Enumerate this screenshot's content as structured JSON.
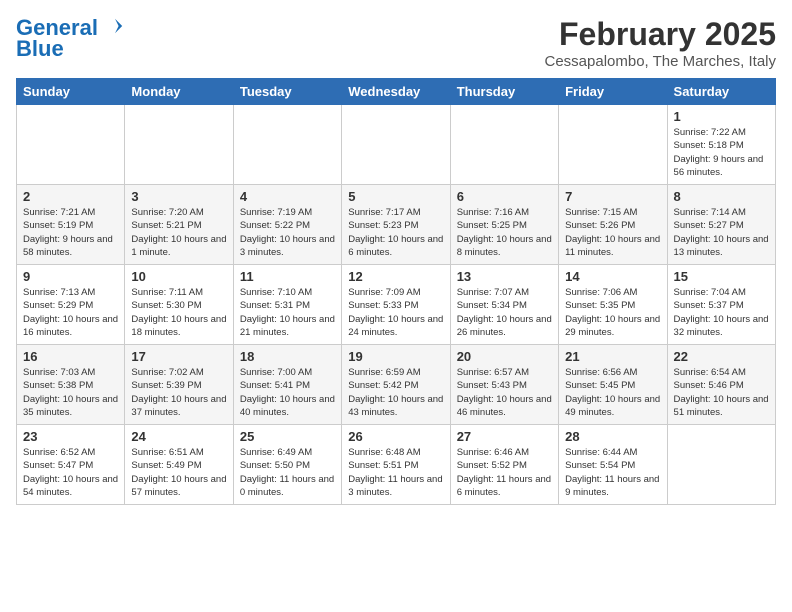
{
  "header": {
    "logo_line1": "General",
    "logo_line2": "Blue",
    "month_title": "February 2025",
    "subtitle": "Cessapalombo, The Marches, Italy"
  },
  "days_of_week": [
    "Sunday",
    "Monday",
    "Tuesday",
    "Wednesday",
    "Thursday",
    "Friday",
    "Saturday"
  ],
  "weeks": [
    [
      {
        "day": "",
        "info": ""
      },
      {
        "day": "",
        "info": ""
      },
      {
        "day": "",
        "info": ""
      },
      {
        "day": "",
        "info": ""
      },
      {
        "day": "",
        "info": ""
      },
      {
        "day": "",
        "info": ""
      },
      {
        "day": "1",
        "info": "Sunrise: 7:22 AM\nSunset: 5:18 PM\nDaylight: 9 hours\nand 56 minutes."
      }
    ],
    [
      {
        "day": "2",
        "info": "Sunrise: 7:21 AM\nSunset: 5:19 PM\nDaylight: 9 hours\nand 58 minutes."
      },
      {
        "day": "3",
        "info": "Sunrise: 7:20 AM\nSunset: 5:21 PM\nDaylight: 10 hours\nand 1 minute."
      },
      {
        "day": "4",
        "info": "Sunrise: 7:19 AM\nSunset: 5:22 PM\nDaylight: 10 hours\nand 3 minutes."
      },
      {
        "day": "5",
        "info": "Sunrise: 7:17 AM\nSunset: 5:23 PM\nDaylight: 10 hours\nand 6 minutes."
      },
      {
        "day": "6",
        "info": "Sunrise: 7:16 AM\nSunset: 5:25 PM\nDaylight: 10 hours\nand 8 minutes."
      },
      {
        "day": "7",
        "info": "Sunrise: 7:15 AM\nSunset: 5:26 PM\nDaylight: 10 hours\nand 11 minutes."
      },
      {
        "day": "8",
        "info": "Sunrise: 7:14 AM\nSunset: 5:27 PM\nDaylight: 10 hours\nand 13 minutes."
      }
    ],
    [
      {
        "day": "9",
        "info": "Sunrise: 7:13 AM\nSunset: 5:29 PM\nDaylight: 10 hours\nand 16 minutes."
      },
      {
        "day": "10",
        "info": "Sunrise: 7:11 AM\nSunset: 5:30 PM\nDaylight: 10 hours\nand 18 minutes."
      },
      {
        "day": "11",
        "info": "Sunrise: 7:10 AM\nSunset: 5:31 PM\nDaylight: 10 hours\nand 21 minutes."
      },
      {
        "day": "12",
        "info": "Sunrise: 7:09 AM\nSunset: 5:33 PM\nDaylight: 10 hours\nand 24 minutes."
      },
      {
        "day": "13",
        "info": "Sunrise: 7:07 AM\nSunset: 5:34 PM\nDaylight: 10 hours\nand 26 minutes."
      },
      {
        "day": "14",
        "info": "Sunrise: 7:06 AM\nSunset: 5:35 PM\nDaylight: 10 hours\nand 29 minutes."
      },
      {
        "day": "15",
        "info": "Sunrise: 7:04 AM\nSunset: 5:37 PM\nDaylight: 10 hours\nand 32 minutes."
      }
    ],
    [
      {
        "day": "16",
        "info": "Sunrise: 7:03 AM\nSunset: 5:38 PM\nDaylight: 10 hours\nand 35 minutes."
      },
      {
        "day": "17",
        "info": "Sunrise: 7:02 AM\nSunset: 5:39 PM\nDaylight: 10 hours\nand 37 minutes."
      },
      {
        "day": "18",
        "info": "Sunrise: 7:00 AM\nSunset: 5:41 PM\nDaylight: 10 hours\nand 40 minutes."
      },
      {
        "day": "19",
        "info": "Sunrise: 6:59 AM\nSunset: 5:42 PM\nDaylight: 10 hours\nand 43 minutes."
      },
      {
        "day": "20",
        "info": "Sunrise: 6:57 AM\nSunset: 5:43 PM\nDaylight: 10 hours\nand 46 minutes."
      },
      {
        "day": "21",
        "info": "Sunrise: 6:56 AM\nSunset: 5:45 PM\nDaylight: 10 hours\nand 49 minutes."
      },
      {
        "day": "22",
        "info": "Sunrise: 6:54 AM\nSunset: 5:46 PM\nDaylight: 10 hours\nand 51 minutes."
      }
    ],
    [
      {
        "day": "23",
        "info": "Sunrise: 6:52 AM\nSunset: 5:47 PM\nDaylight: 10 hours\nand 54 minutes."
      },
      {
        "day": "24",
        "info": "Sunrise: 6:51 AM\nSunset: 5:49 PM\nDaylight: 10 hours\nand 57 minutes."
      },
      {
        "day": "25",
        "info": "Sunrise: 6:49 AM\nSunset: 5:50 PM\nDaylight: 11 hours\nand 0 minutes."
      },
      {
        "day": "26",
        "info": "Sunrise: 6:48 AM\nSunset: 5:51 PM\nDaylight: 11 hours\nand 3 minutes."
      },
      {
        "day": "27",
        "info": "Sunrise: 6:46 AM\nSunset: 5:52 PM\nDaylight: 11 hours\nand 6 minutes."
      },
      {
        "day": "28",
        "info": "Sunrise: 6:44 AM\nSunset: 5:54 PM\nDaylight: 11 hours\nand 9 minutes."
      },
      {
        "day": "",
        "info": ""
      }
    ]
  ]
}
